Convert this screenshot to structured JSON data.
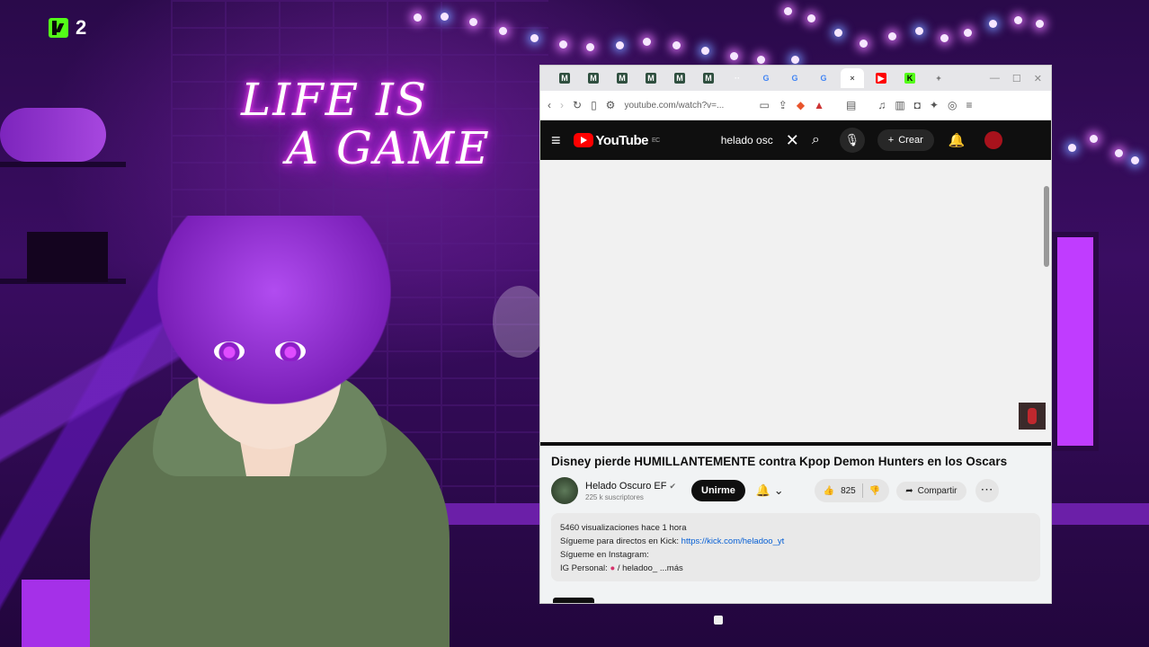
{
  "overlay": {
    "kick_count": "2",
    "neon_line1": "LIFE IS",
    "neon_line2": "A GAME"
  },
  "browser": {
    "tabs": [
      {
        "icon": "generic-tab-icon",
        "label": "M"
      },
      {
        "icon": "generic-tab-icon",
        "label": "M"
      },
      {
        "icon": "generic-tab-icon",
        "label": "M"
      },
      {
        "icon": "generic-tab-icon",
        "label": "M"
      },
      {
        "icon": "generic-tab-icon",
        "label": "M"
      },
      {
        "icon": "generic-tab-icon",
        "label": "M"
      },
      {
        "icon": "dots-icon",
        "label": "··"
      },
      {
        "icon": "google-icon",
        "label": "G"
      },
      {
        "icon": "google-icon",
        "label": "G"
      },
      {
        "icon": "google-icon",
        "label": "G"
      },
      {
        "icon": "close-icon",
        "label": "×"
      },
      {
        "icon": "youtube-icon",
        "label": "▶"
      },
      {
        "icon": "kick-icon",
        "label": "K"
      },
      {
        "icon": "new-tab-icon",
        "label": "+"
      }
    ],
    "url": "youtube.com/watch?v=..."
  },
  "youtube": {
    "logo_text": "YouTube",
    "logo_sup": "EC",
    "search_query": "helado osc",
    "create_label": "Crear",
    "video": {
      "title": "Disney pierde HUMILLANTEMENTE contra Kpop Demon Hunters en los Oscars",
      "channel_name": "Helado Oscuro EF",
      "channel_subs": "225 k suscriptores",
      "join_label": "Unirme",
      "likes": "825",
      "share_label": "Compartir",
      "description": {
        "meta": "5460 visualizaciones  hace 1 hora",
        "line1_text": "Sígueme para directos en Kick: ",
        "line1_link": "https://kick.com/heladoo_yt",
        "line2": "Sígueme en Instagram:",
        "line3_text": "IG Personal:  ",
        "line3_handle": "/ heladoo_",
        "more_label": "...más"
      }
    }
  },
  "colors": {
    "kick_green": "#53fc18",
    "youtube_red": "#ff0000",
    "neon_pink": "#ff4cf2"
  }
}
